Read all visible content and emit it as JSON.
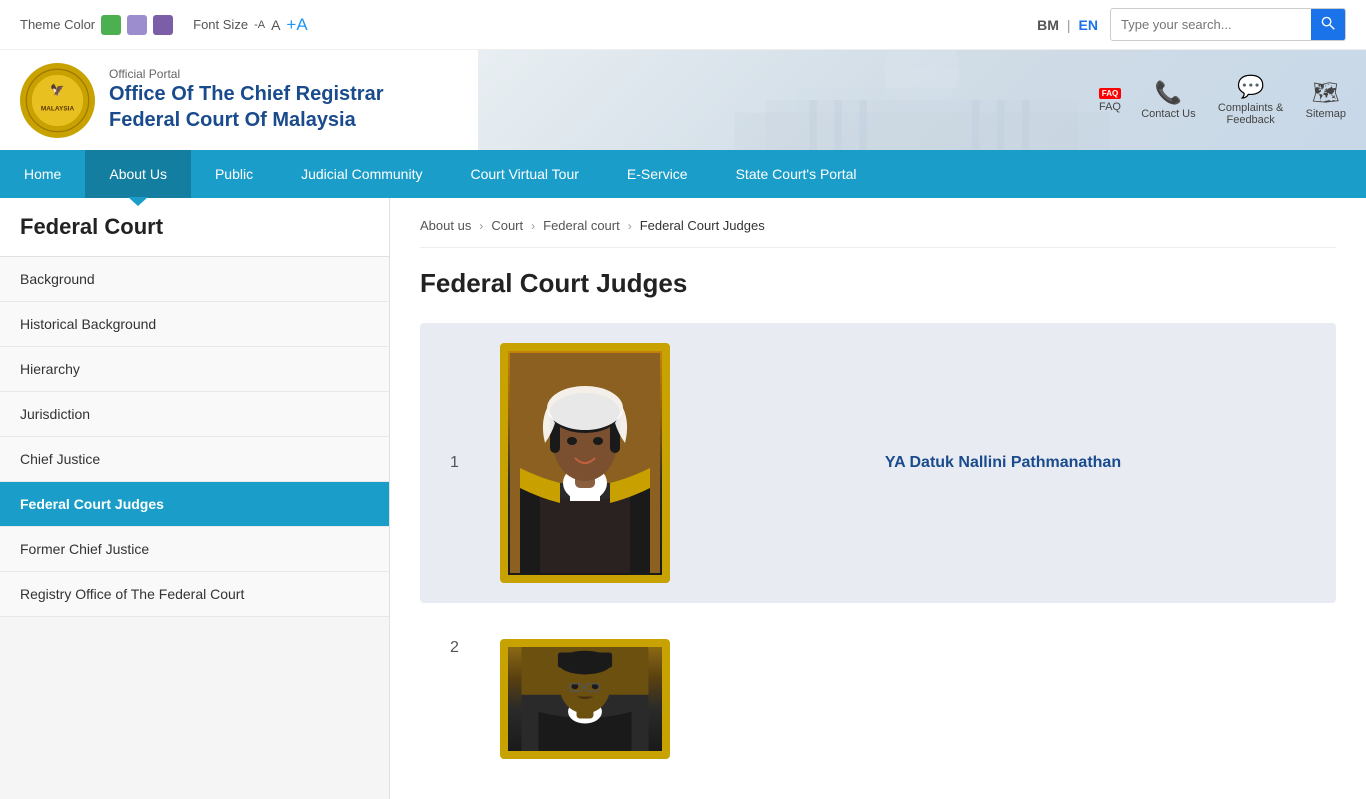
{
  "topbar": {
    "theme_label": "Theme Color",
    "font_label": "Font Size",
    "font_small": "-A",
    "font_medium": "A",
    "font_large": "+A",
    "lang_bm": "BM",
    "lang_en": "EN",
    "search_placeholder": "Type your search..."
  },
  "colors": {
    "green": "#4caf50",
    "purple_light": "#9c8dce",
    "purple_dark": "#7b5ea7",
    "nav_blue": "#1a9ec9",
    "link_blue": "#1a4b8c",
    "active_blue": "#1a9ec9"
  },
  "header": {
    "official_portal": "Official Portal",
    "title_line1": "Office Of The Chief Registrar",
    "title_line2": "Federal Court Of Malaysia",
    "faq_label": "FAQ",
    "contact_label": "Contact Us",
    "complaints_label": "Complaints & Feedback",
    "sitemap_label": "Sitemap"
  },
  "nav": {
    "items": [
      {
        "label": "Home",
        "active": false
      },
      {
        "label": "About Us",
        "active": true
      },
      {
        "label": "Public",
        "active": false
      },
      {
        "label": "Judicial Community",
        "active": false
      },
      {
        "label": "Court Virtual Tour",
        "active": false
      },
      {
        "label": "E-Service",
        "active": false
      },
      {
        "label": "State Court's Portal",
        "active": false
      }
    ]
  },
  "sidebar": {
    "title": "Federal Court",
    "items": [
      {
        "label": "Background",
        "active": false
      },
      {
        "label": "Historical Background",
        "active": false
      },
      {
        "label": "Hierarchy",
        "active": false
      },
      {
        "label": "Jurisdiction",
        "active": false
      },
      {
        "label": "Chief Justice",
        "active": false
      },
      {
        "label": "Federal Court Judges",
        "active": true
      },
      {
        "label": "Former Chief Justice",
        "active": false
      },
      {
        "label": "Registry Office of The Federal Court",
        "active": false
      }
    ]
  },
  "breadcrumb": {
    "items": [
      {
        "label": "About us"
      },
      {
        "label": "Court"
      },
      {
        "label": "Federal court"
      },
      {
        "label": "Federal Court Judges"
      }
    ]
  },
  "content": {
    "page_title": "Federal Court Judges",
    "judges": [
      {
        "number": "1",
        "name": "YA Datuk Nallini Pathmanathan",
        "gender": "female"
      },
      {
        "number": "2",
        "name": "",
        "gender": "male"
      }
    ]
  }
}
